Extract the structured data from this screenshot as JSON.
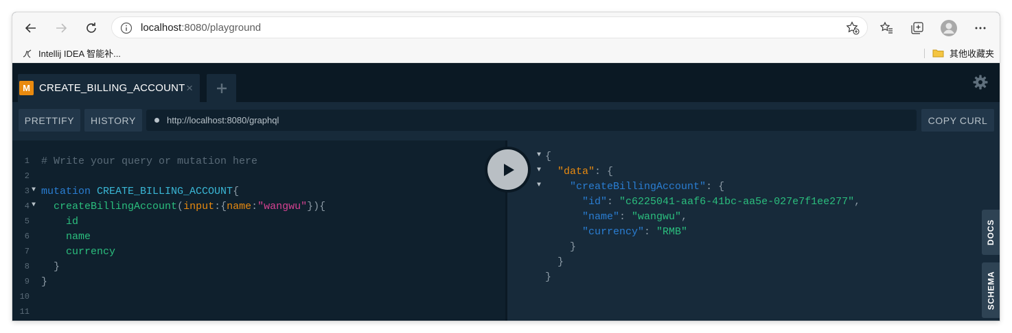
{
  "browser": {
    "url_host": "localhost",
    "url_path": ":8080/playground",
    "bookmark_label": "Intellij IDEA 智能补...",
    "other_bookmarks_label": "其他收藏夹"
  },
  "playground": {
    "tab": {
      "badge": "M",
      "title": "CREATE_BILLING_ACCOUNT",
      "close": "×"
    },
    "buttons": {
      "prettify": "PRETTIFY",
      "history": "HISTORY",
      "copy_curl": "COPY CURL"
    },
    "endpoint": "http://localhost:8080/graphql",
    "side_tabs": {
      "docs": "DOCS",
      "schema": "SCHEMA"
    },
    "editor_lines": [
      "1",
      "2",
      "3",
      "4",
      "5",
      "6",
      "7",
      "8",
      "9",
      "10",
      "11"
    ],
    "editor": {
      "comment": "# Write your query or mutation here",
      "keyword": "mutation",
      "operation": "CREATE_BILLING_ACCOUNT",
      "field": "createBillingAccount",
      "arg": "input",
      "arg_key": "name",
      "arg_value": "\"wangwu\"",
      "fields": [
        "id",
        "name",
        "currency"
      ]
    },
    "result": {
      "data_key": "\"data\"",
      "field_key": "\"createBillingAccount\"",
      "id_key": "\"id\"",
      "id_value": "\"c6225041-aaf6-41bc-aa5e-027e7f1ee277\"",
      "name_key": "\"name\"",
      "name_value": "\"wangwu\"",
      "currency_key": "\"currency\"",
      "currency_value": "\"RMB\""
    }
  },
  "colors": {
    "editor_bg": "#0f202d",
    "panel_bg": "#172a3a",
    "badge": "#e98a0f",
    "keyword": "#2a7ed3",
    "string": "#d64292",
    "field": "#2bbf7e"
  }
}
